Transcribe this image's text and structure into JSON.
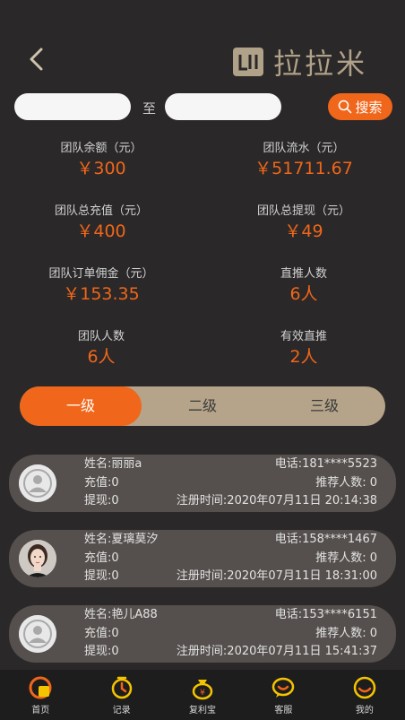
{
  "header": {
    "logo_text": "拉拉米",
    "logo_icon": "logo-mark-icon",
    "back_icon": "chevron-left-icon"
  },
  "filter": {
    "start_value": "",
    "end_value": "",
    "separator": "至",
    "search_label": "搜索",
    "search_icon": "search-icon"
  },
  "stats": [
    {
      "label": "团队余额（元）",
      "value": "￥300"
    },
    {
      "label": "团队流水（元）",
      "value": "￥51711.67"
    },
    {
      "label": "团队总充值（元）",
      "value": "￥400"
    },
    {
      "label": "团队总提现（元）",
      "value": "￥49"
    },
    {
      "label": "团队订单佣金（元）",
      "value": "￥153.35"
    },
    {
      "label": "直推人数",
      "value": "6人"
    },
    {
      "label": "团队人数",
      "value": "6人"
    },
    {
      "label": "有效直推",
      "value": "2人"
    }
  ],
  "level_tabs": {
    "items": [
      "一级",
      "二级",
      "三级"
    ],
    "active": "一级"
  },
  "members": [
    {
      "name": "姓名:丽丽a",
      "phone": "电话:181****5523",
      "recharge": "充值:0",
      "referrals": "推荐人数: 0",
      "withdraw": "提现:0",
      "registered": "注册时间:2020年07月11日 20:14:38",
      "avatar": "default-avatar-icon"
    },
    {
      "name": "姓名:夏璃莫汐",
      "phone": "电话:158****1467",
      "recharge": "充值:0",
      "referrals": "推荐人数: 0",
      "withdraw": "提现:0",
      "registered": "注册时间:2020年07月11日 18:31:00",
      "avatar": "photo-avatar"
    },
    {
      "name": "姓名:艳儿A88",
      "phone": "电话:153****6151",
      "recharge": "充值:0",
      "referrals": "推荐人数: 0",
      "withdraw": "提现:0",
      "registered": "注册时间:2020年07月11日 15:41:37",
      "avatar": "default-avatar-icon"
    }
  ],
  "tabbar": [
    {
      "label": "首页",
      "icon": "home-icon"
    },
    {
      "label": "记录",
      "icon": "record-icon"
    },
    {
      "label": "复利宝",
      "icon": "money-bag-icon"
    },
    {
      "label": "客服",
      "icon": "chat-icon"
    },
    {
      "label": "我的",
      "icon": "profile-icon"
    }
  ],
  "colors": {
    "accent": "#f0661a",
    "gold": "#b5a489",
    "bg": "#2a2828",
    "card": "#55504e"
  }
}
